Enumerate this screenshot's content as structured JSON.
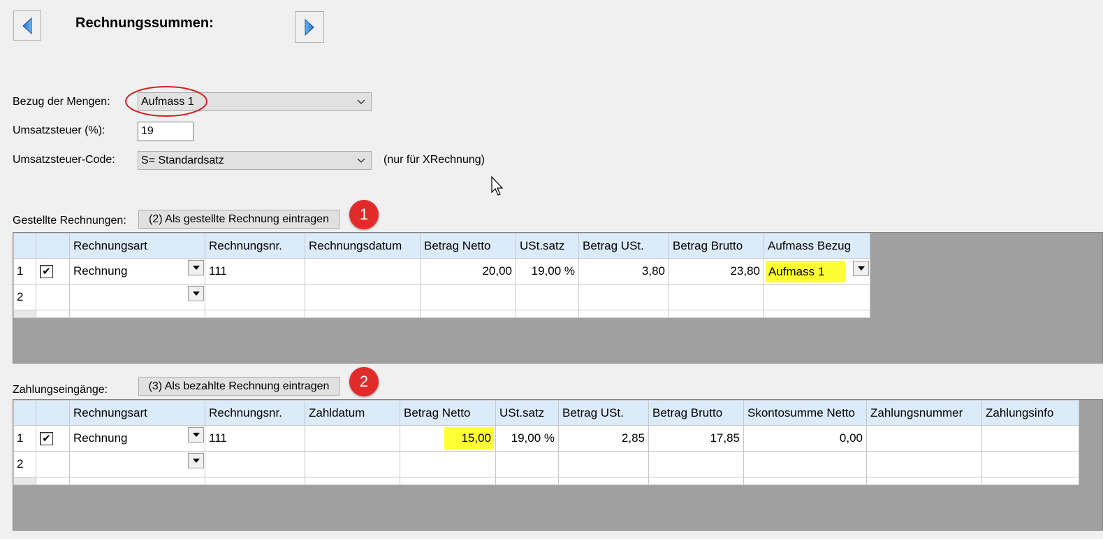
{
  "header": {
    "prev_icon": "triangle-left-icon",
    "next_icon": "triangle-right-icon",
    "title": "Rechnungssummen:"
  },
  "form": {
    "bezug_label": "Bezug der Mengen:",
    "bezug_value": "Aufmass 1",
    "ust_label": "Umsatzsteuer (%):",
    "ust_value": "19",
    "code_label": "Umsatzsteuer-Code:",
    "code_value": "S= Standardsatz",
    "code_note": "(nur für XRechnung)"
  },
  "invoices": {
    "label": "Gestellte Rechnungen:",
    "button": "(2) Als gestellte Rechnung eintragen",
    "badge": "1",
    "columns": [
      "Rechnungsart",
      "Rechnungsnr.",
      "Rechnungsdatum",
      "Betrag Netto",
      "USt.satz",
      "Betrag USt.",
      "Betrag Brutto",
      "Aufmass Bezug"
    ],
    "rows": [
      {
        "num": "1",
        "checked": true,
        "art": "Rechnung",
        "nr": "111",
        "datum": "",
        "netto": "20,00",
        "satz": "19,00 %",
        "ust": "3,80",
        "brutto": "23,80",
        "bezug": "Aufmass 1"
      },
      {
        "num": "2",
        "checked": false,
        "art": "",
        "nr": "",
        "datum": "",
        "netto": "",
        "satz": "",
        "ust": "",
        "brutto": "",
        "bezug": ""
      }
    ]
  },
  "payments": {
    "label": "Zahlungseingänge:",
    "button": "(3) Als bezahlte Rechnung eintragen",
    "badge": "2",
    "columns": [
      "Rechnungsart",
      "Rechnungsnr.",
      "Zahldatum",
      "Betrag Netto",
      "USt.satz",
      "Betrag USt.",
      "Betrag Brutto",
      "Skontosumme Netto",
      "Zahlungsnummer",
      "Zahlungsinfo"
    ],
    "rows": [
      {
        "num": "1",
        "checked": true,
        "art": "Rechnung",
        "nr": "111",
        "datum": "",
        "netto": "15,00",
        "satz": "19,00 %",
        "ust": "2,85",
        "brutto": "17,85",
        "skonto": "0,00",
        "zahlnr": "",
        "info": ""
      },
      {
        "num": "2",
        "checked": false,
        "art": "",
        "nr": "",
        "datum": "",
        "netto": "",
        "satz": "",
        "ust": "",
        "brutto": "",
        "skonto": "",
        "zahlnr": "",
        "info": ""
      }
    ]
  },
  "colors": {
    "header_bg": "#dcebfa",
    "highlight": "#ffff33",
    "badge": "#e12b2b",
    "grid_empty": "#a0a0a0",
    "annotation_circle": "#d42020"
  }
}
